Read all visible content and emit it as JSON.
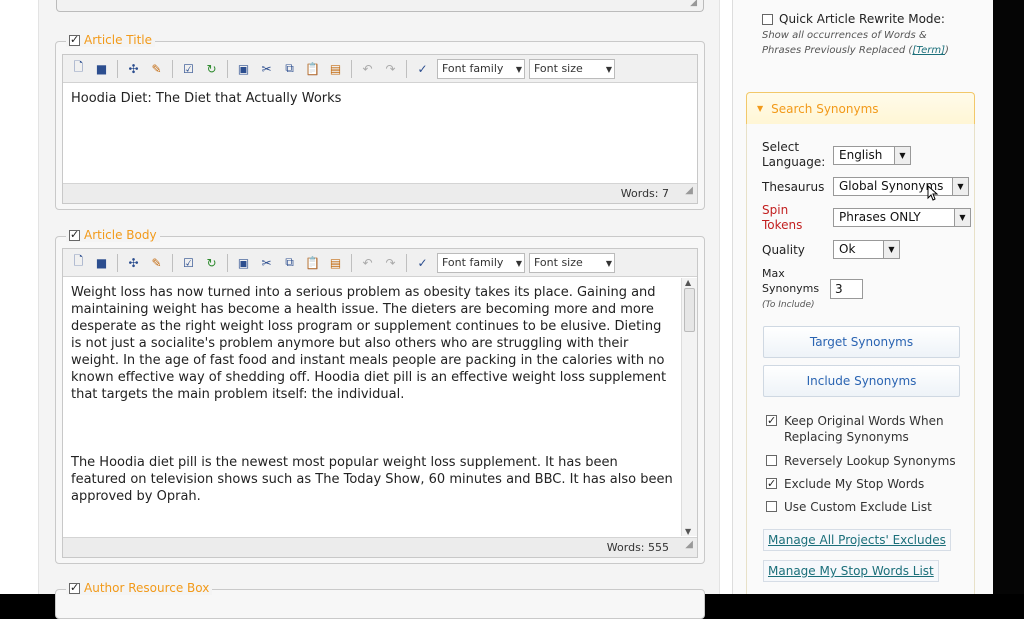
{
  "editor_toolbar": {
    "font_family": "Font family",
    "font_size": "Font size"
  },
  "article_title": {
    "legend": "Article Title",
    "content": "Hoodia Diet: The Diet that Actually Works",
    "word_count": "Words: 7"
  },
  "article_body": {
    "legend": "Article Body",
    "paragraphs": [
      "Weight loss has now turned into a serious problem as obesity takes its place. Gaining and maintaining weight has become a health issue. The dieters are becoming more and more desperate as the right weight loss program or supplement continues to be elusive. Dieting is not just a socialite's problem anymore but also others who are struggling with their weight. In the age of fast food and instant meals people are packing in the calories with no known effective way of shedding off. Hoodia diet pill is an effective weight loss supplement that targets the main problem itself: the individual.",
      "The Hoodia diet pill is the newest most popular weight loss supplement. It has been featured on television shows such as The Today Show, 60 minutes and BBC. It has also been approved by Oprah."
    ],
    "word_count": "Words: 555"
  },
  "author_resource": {
    "legend": "Author Resource Box"
  },
  "sidebar": {
    "quick_rewrite_label": "Quick Article Rewrite Mode:",
    "quick_rewrite_note": "Show all occurrences of Words & Phrases Previously Replaced (",
    "quick_rewrite_term": "[Term]",
    "quick_rewrite_note_end": ")",
    "panel_title": "Search Synonyms",
    "select_language_label": "Select Language:",
    "language_value": "English",
    "thesaurus_label": "Thesaurus",
    "thesaurus_value": "Global Synonyms",
    "spin_tokens_label": "Spin Tokens",
    "spin_tokens_value": "Phrases ONLY",
    "quality_label": "Quality",
    "quality_value": "Ok",
    "max_synonyms_label": "Max Synonyms",
    "max_synonyms_note": "(To Include)",
    "max_synonyms_value": "3",
    "target_button": "Target Synonyms",
    "include_button": "Include Synonyms",
    "options": [
      {
        "label": "Keep Original Words When Replacing Synonyms",
        "checked": true
      },
      {
        "label": "Reversely Lookup Synonyms",
        "checked": false
      },
      {
        "label": "Exclude My Stop Words",
        "checked": true
      },
      {
        "label": "Use Custom Exclude List",
        "checked": false
      }
    ],
    "manage_excludes": "Manage All Projects' Excludes",
    "manage_stopwords": "Manage My Stop Words List"
  },
  "colors": {
    "legend_orange": "#f29a1a",
    "spin_red": "#c21f1f",
    "button_blue": "#2a64b2",
    "link_teal": "#1b6f7a"
  }
}
